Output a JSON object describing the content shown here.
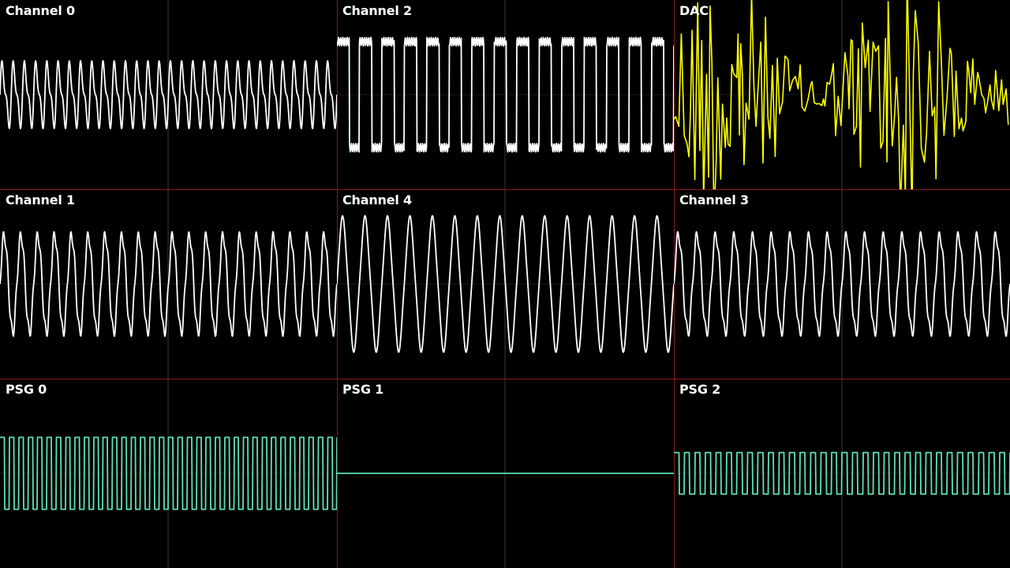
{
  "app": {
    "background_color": "#000000",
    "divider_color": "#8b1a1a",
    "centerline_color": "#3a3a3a"
  },
  "panels": [
    {
      "id": "channel-0",
      "label": "Channel 0",
      "row": 0,
      "col": 0,
      "color": "#ffffff",
      "waveform": "sawtooth-ish",
      "cycles": 30,
      "amplitude": 0.18
    },
    {
      "id": "channel-2",
      "label": "Channel 2",
      "row": 0,
      "col": 1,
      "color": "#ffffff",
      "waveform": "pulse",
      "cycles": 15,
      "amplitude": 0.28
    },
    {
      "id": "dac",
      "label": "DAC",
      "row": 0,
      "col": 2,
      "color": "#ffff00",
      "waveform": "noise",
      "cycles": 0,
      "amplitude": 0.7
    },
    {
      "id": "channel-1",
      "label": "Channel 1",
      "row": 1,
      "col": 0,
      "color": "#ffffff",
      "waveform": "sine-bumpy",
      "cycles": 20,
      "amplitude": 0.27
    },
    {
      "id": "channel-4",
      "label": "Channel 4",
      "row": 1,
      "col": 1,
      "color": "#ffffff",
      "waveform": "sine",
      "cycles": 15,
      "amplitude": 0.34
    },
    {
      "id": "channel-3",
      "label": "Channel 3",
      "row": 1,
      "col": 2,
      "color": "#ffffff",
      "waveform": "sine-bumpy",
      "cycles": 18,
      "amplitude": 0.27
    },
    {
      "id": "psg-0",
      "label": "PSG 0",
      "row": 2,
      "col": 0,
      "color": "#5fe0b8",
      "waveform": "square",
      "cycles": 36,
      "amplitude": 0.19
    },
    {
      "id": "psg-1",
      "label": "PSG 1",
      "row": 2,
      "col": 1,
      "color": "#5fe0b8",
      "waveform": "flat",
      "cycles": 0,
      "amplitude": 0
    },
    {
      "id": "psg-2",
      "label": "PSG 2",
      "row": 2,
      "col": 2,
      "color": "#5fe0b8",
      "waveform": "square",
      "cycles": 32,
      "amplitude": 0.11
    }
  ]
}
